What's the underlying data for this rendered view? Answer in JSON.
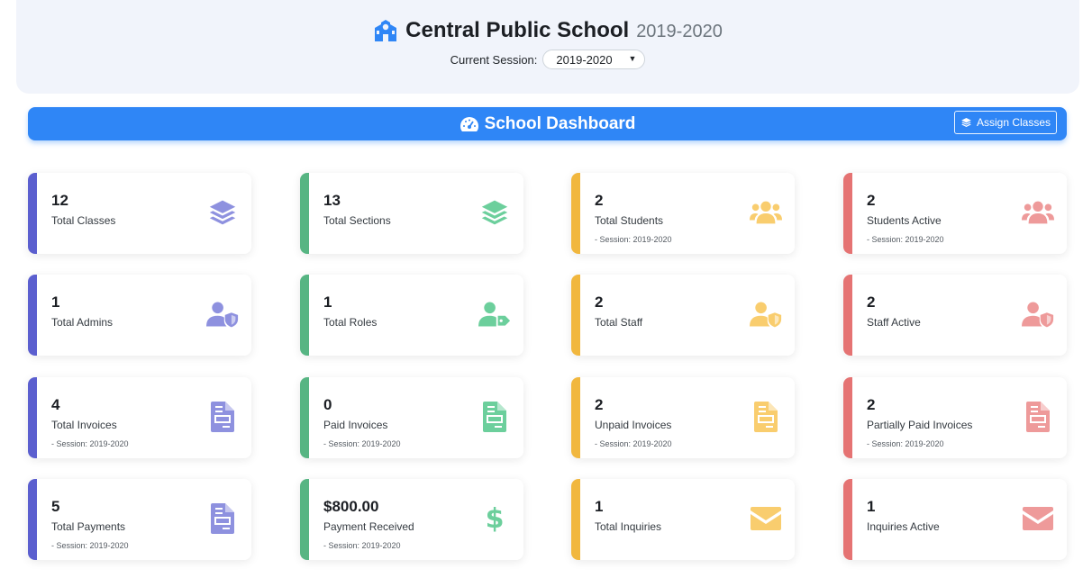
{
  "header": {
    "school_name": "Central Public School",
    "school_year": "2019-2020",
    "session_label": "Current Session:",
    "session_selected": "2019-2020",
    "icon": "school-icon"
  },
  "dashboard": {
    "title": "School Dashboard",
    "title_icon": "gauge-icon",
    "assign_label": "Assign Classes",
    "assign_icon": "layers-icon"
  },
  "colors": {
    "blue": "#5b5fcf",
    "green": "#57b583",
    "yellow": "#f1b73e",
    "red": "#e57373",
    "dashboard_bar": "#2f86f6"
  },
  "cards": [
    {
      "value": "12",
      "label": "Total Classes",
      "sub": "",
      "icon": "layers-icon",
      "color": "blue"
    },
    {
      "value": "13",
      "label": "Total Sections",
      "sub": "",
      "icon": "layers-icon",
      "color": "green"
    },
    {
      "value": "2",
      "label": "Total Students",
      "sub": "- Session: 2019-2020",
      "icon": "users-icon",
      "color": "yellow"
    },
    {
      "value": "2",
      "label": "Students Active",
      "sub": "- Session: 2019-2020",
      "icon": "users-icon",
      "color": "red"
    },
    {
      "value": "1",
      "label": "Total Admins",
      "sub": "",
      "icon": "user-shield-icon",
      "color": "blue"
    },
    {
      "value": "1",
      "label": "Total Roles",
      "sub": "",
      "icon": "user-tag-icon",
      "color": "green"
    },
    {
      "value": "2",
      "label": "Total Staff",
      "sub": "",
      "icon": "user-shield-icon",
      "color": "yellow"
    },
    {
      "value": "2",
      "label": "Staff Active",
      "sub": "",
      "icon": "user-shield-icon",
      "color": "red"
    },
    {
      "value": "4",
      "label": "Total Invoices",
      "sub": "- Session: 2019-2020",
      "icon": "invoice-icon",
      "color": "blue"
    },
    {
      "value": "0",
      "label": "Paid Invoices",
      "sub": "- Session: 2019-2020",
      "icon": "invoice-icon",
      "color": "green"
    },
    {
      "value": "2",
      "label": "Unpaid Invoices",
      "sub": "- Session: 2019-2020",
      "icon": "invoice-icon",
      "color": "yellow"
    },
    {
      "value": "2",
      "label": "Partially Paid Invoices",
      "sub": "- Session: 2019-2020",
      "icon": "invoice-icon",
      "color": "red"
    },
    {
      "value": "5",
      "label": "Total Payments",
      "sub": "- Session: 2019-2020",
      "icon": "invoice-icon",
      "color": "blue"
    },
    {
      "value": "$800.00",
      "label": "Payment Received",
      "sub": "- Session: 2019-2020",
      "icon": "dollar-icon",
      "dollar": "$",
      "color": "green"
    },
    {
      "value": "1",
      "label": "Total Inquiries",
      "sub": "",
      "icon": "envelope-icon",
      "color": "yellow"
    },
    {
      "value": "1",
      "label": "Inquiries Active",
      "sub": "",
      "icon": "envelope-icon",
      "color": "red"
    }
  ]
}
